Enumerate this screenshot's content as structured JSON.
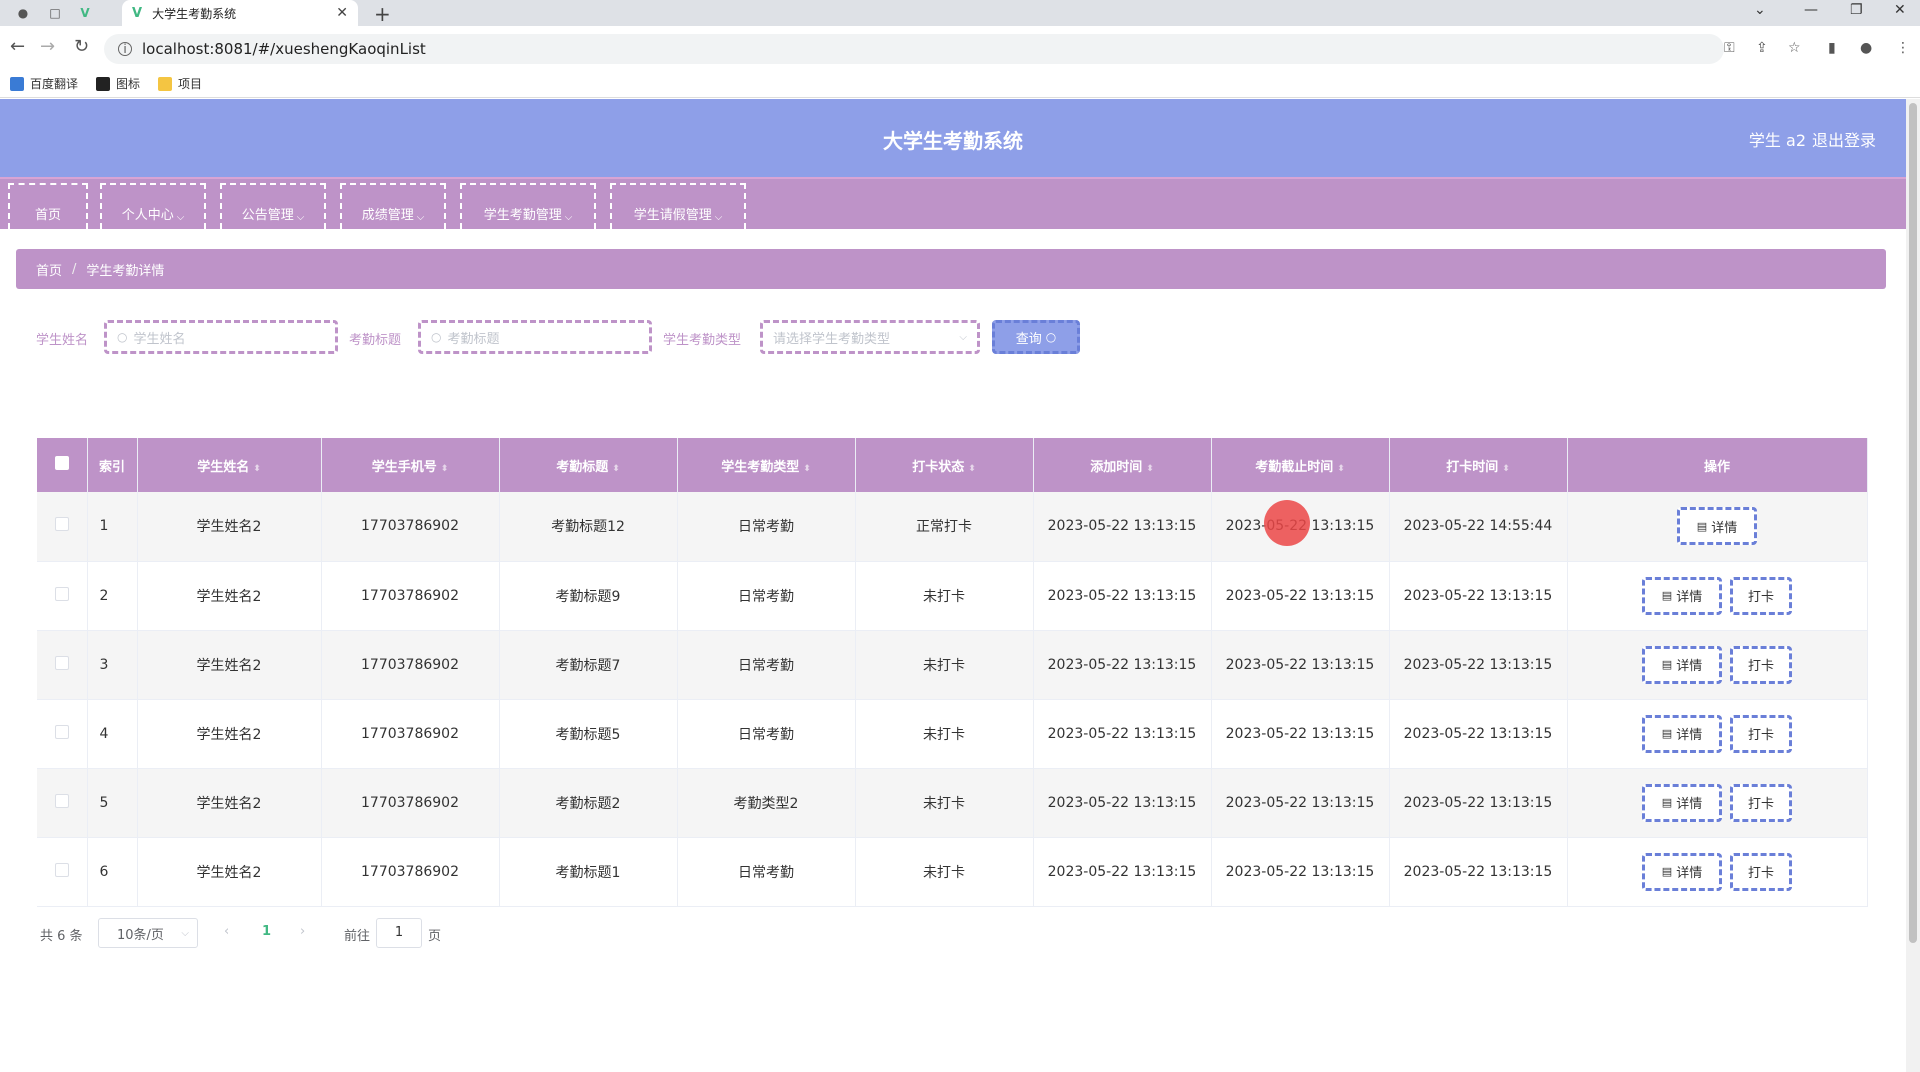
{
  "browser": {
    "tab_title": "大学生考勤系统",
    "url": "localhost:8081/#/xueshengKaoqinList",
    "bookmarks": [
      "百度翻译",
      "图标",
      "项目"
    ]
  },
  "header": {
    "title": "大学生考勤系统",
    "user": "学生 a2",
    "logout": "退出登录"
  },
  "menu": [
    "首页",
    "个人中心",
    "公告管理",
    "成绩管理",
    "学生考勤管理",
    "学生请假管理"
  ],
  "breadcrumb": {
    "home": "首页",
    "current": "学生考勤详情"
  },
  "search": {
    "name_label": "学生姓名",
    "name_placeholder": "学生姓名",
    "title_label": "考勤标题",
    "title_placeholder": "考勤标题",
    "type_label": "学生考勤类型",
    "type_placeholder": "请选择学生考勤类型",
    "query_button": "查询"
  },
  "table": {
    "columns": [
      "索引",
      "学生姓名",
      "学生手机号",
      "考勤标题",
      "学生考勤类型",
      "打卡状态",
      "添加时间",
      "考勤截止时间",
      "打卡时间",
      "操作"
    ],
    "rows": [
      {
        "idx": "1",
        "name": "学生姓名2",
        "phone": "17703786902",
        "title": "考勤标题12",
        "type": "日常考勤",
        "status": "正常打卡",
        "added": "2023-05-22 13:13:15",
        "deadline": "2023-05-22 13:13:15",
        "punch": "2023-05-22 14:55:44"
      },
      {
        "idx": "2",
        "name": "学生姓名2",
        "phone": "17703786902",
        "title": "考勤标题9",
        "type": "日常考勤",
        "status": "未打卡",
        "added": "2023-05-22 13:13:15",
        "deadline": "2023-05-22 13:13:15",
        "punch": "2023-05-22 13:13:15"
      },
      {
        "idx": "3",
        "name": "学生姓名2",
        "phone": "17703786902",
        "title": "考勤标题7",
        "type": "日常考勤",
        "status": "未打卡",
        "added": "2023-05-22 13:13:15",
        "deadline": "2023-05-22 13:13:15",
        "punch": "2023-05-22 13:13:15"
      },
      {
        "idx": "4",
        "name": "学生姓名2",
        "phone": "17703786902",
        "title": "考勤标题5",
        "type": "日常考勤",
        "status": "未打卡",
        "added": "2023-05-22 13:13:15",
        "deadline": "2023-05-22 13:13:15",
        "punch": "2023-05-22 13:13:15"
      },
      {
        "idx": "5",
        "name": "学生姓名2",
        "phone": "17703786902",
        "title": "考勤标题2",
        "type": "考勤类型2",
        "status": "未打卡",
        "added": "2023-05-22 13:13:15",
        "deadline": "2023-05-22 13:13:15",
        "punch": "2023-05-22 13:13:15"
      },
      {
        "idx": "6",
        "name": "学生姓名2",
        "phone": "17703786902",
        "title": "考勤标题1",
        "type": "日常考勤",
        "status": "未打卡",
        "added": "2023-05-22 13:13:15",
        "deadline": "2023-05-22 13:13:15",
        "punch": "2023-05-22 13:13:15"
      }
    ],
    "detail_label": "详情",
    "punch_label": "打卡"
  },
  "pagination": {
    "total": "共 6 条",
    "page_size": "10条/页",
    "current_page": "1",
    "goto_label": "前往",
    "goto_value": "1",
    "page_suffix": "页"
  },
  "colors": {
    "header": "#8e9fe8",
    "menu": "#be93c8",
    "accent": "#41b883"
  }
}
